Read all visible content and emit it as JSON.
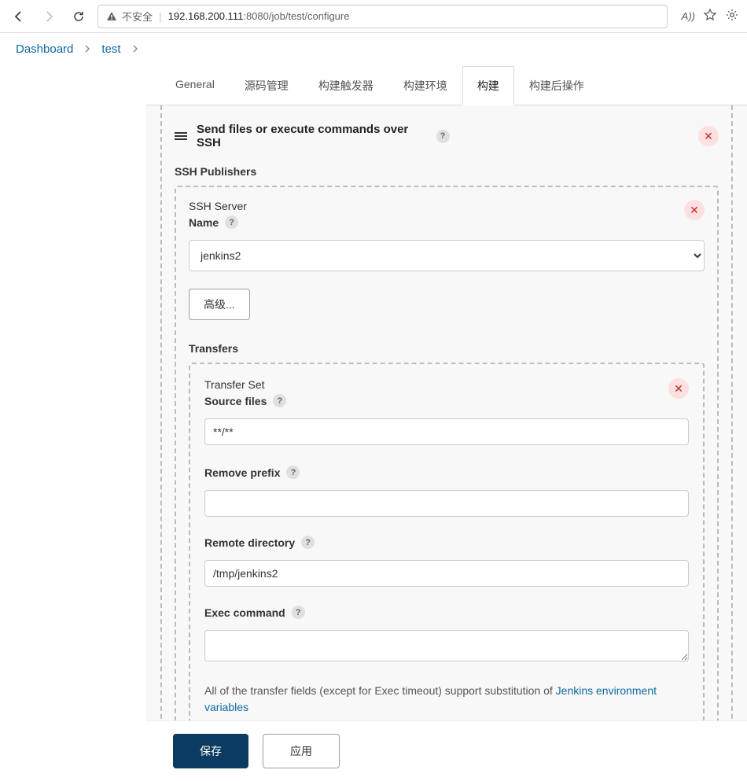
{
  "browser": {
    "insecure_label": "不安全",
    "url_host": "192.168.200.111",
    "url_port_path": ":8080/job/test/configure",
    "read_aloud": "A))"
  },
  "breadcrumbs": {
    "items": [
      "Dashboard",
      "test"
    ]
  },
  "tabs": {
    "items": [
      {
        "label": "General",
        "active": false
      },
      {
        "label": "源码管理",
        "active": false
      },
      {
        "label": "构建触发器",
        "active": false
      },
      {
        "label": "构建环境",
        "active": false
      },
      {
        "label": "构建",
        "active": true
      },
      {
        "label": "构建后操作",
        "active": false
      }
    ]
  },
  "step": {
    "title": "Send files or execute commands over SSH",
    "publishers_label": "SSH Publishers",
    "server_label": "SSH Server",
    "name_label": "Name",
    "server_name_value": "jenkins2",
    "advanced_label": "高级...",
    "transfers_label": "Transfers",
    "transfer_set_label": "Transfer Set",
    "source_files_label": "Source files",
    "source_files_value": "**/**",
    "remove_prefix_label": "Remove prefix",
    "remove_prefix_value": "",
    "remote_directory_label": "Remote directory",
    "remote_directory_value": "/tmp/jenkins2",
    "exec_command_label": "Exec command",
    "exec_command_value": "",
    "hint_prefix": "All of the transfer fields (except for Exec timeout) support substitution of ",
    "hint_link": "Jenkins environment variables"
  },
  "footer": {
    "save_label": "保存",
    "apply_label": "应用"
  }
}
